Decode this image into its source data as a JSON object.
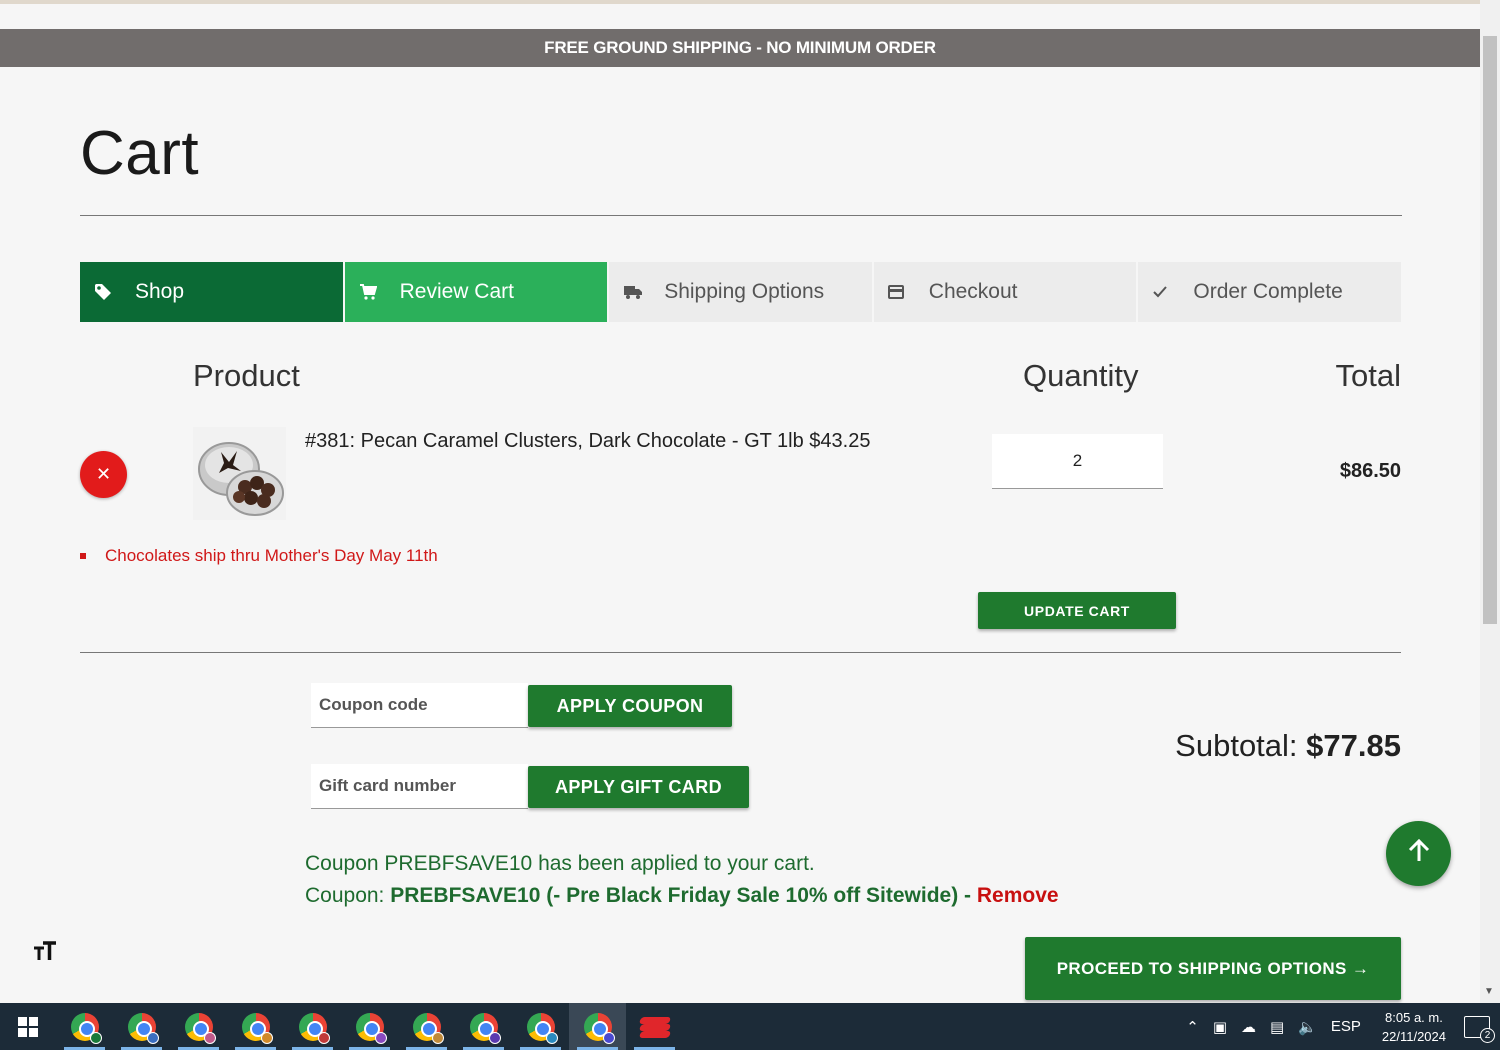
{
  "promo": {
    "text": "FREE GROUND SHIPPING - NO MINIMUM ORDER"
  },
  "page": {
    "title": "Cart"
  },
  "steps": [
    {
      "label": "Shop",
      "icon": "tag-icon",
      "state": "done"
    },
    {
      "label": "Review Cart",
      "icon": "cart-icon",
      "state": "active"
    },
    {
      "label": "Shipping Options",
      "icon": "truck-icon",
      "state": "pending"
    },
    {
      "label": "Checkout",
      "icon": "credit-card-icon",
      "state": "pending"
    },
    {
      "label": "Order Complete",
      "icon": "check-icon",
      "state": "pending"
    }
  ],
  "cart": {
    "headers": {
      "product": "Product",
      "quantity": "Quantity",
      "total": "Total"
    },
    "item": {
      "name": "#381: Pecan Caramel Clusters, Dark Chocolate - GT 1lb $43.25",
      "quantity": "2",
      "total": "$86.50"
    },
    "notice": "Chocolates ship thru Mother's Day May 11th",
    "update_label": "UPDATE CART"
  },
  "coupon": {
    "placeholder": "Coupon code",
    "apply_label": "APPLY COUPON"
  },
  "giftcard": {
    "placeholder": "Gift card number",
    "apply_label": "APPLY GIFT CARD"
  },
  "subtotal": {
    "label": "Subtotal:",
    "value": "$77.85"
  },
  "coupon_status": {
    "message": "Coupon PREBFSAVE10 has been applied to your cart.",
    "prefix": "Coupon:",
    "detail": "PREBFSAVE10 (- Pre Black Friday Sale 10% off Sitewide) -",
    "remove_label": "Remove"
  },
  "proceed": {
    "label": "PROCEED TO SHIPPING OPTIONS →"
  },
  "accessibility": {
    "text_size_icon": "text-size-icon",
    "text_size_glyph": "ᴛТ"
  },
  "colors": {
    "brand_dark_green": "#0b6a35",
    "active_green": "#2bb05a",
    "button_green": "#1f7a2e",
    "alert_red": "#d01818",
    "promo_gray": "#716d6c"
  },
  "taskbar": {
    "apps": [
      "chrome",
      "chrome",
      "chrome",
      "chrome",
      "chrome",
      "chrome",
      "chrome",
      "chrome",
      "chrome",
      "chrome",
      "red-app"
    ],
    "language": "ESP",
    "time": "8:05 a. m.",
    "date": "22/11/2024",
    "notifications": "2"
  }
}
